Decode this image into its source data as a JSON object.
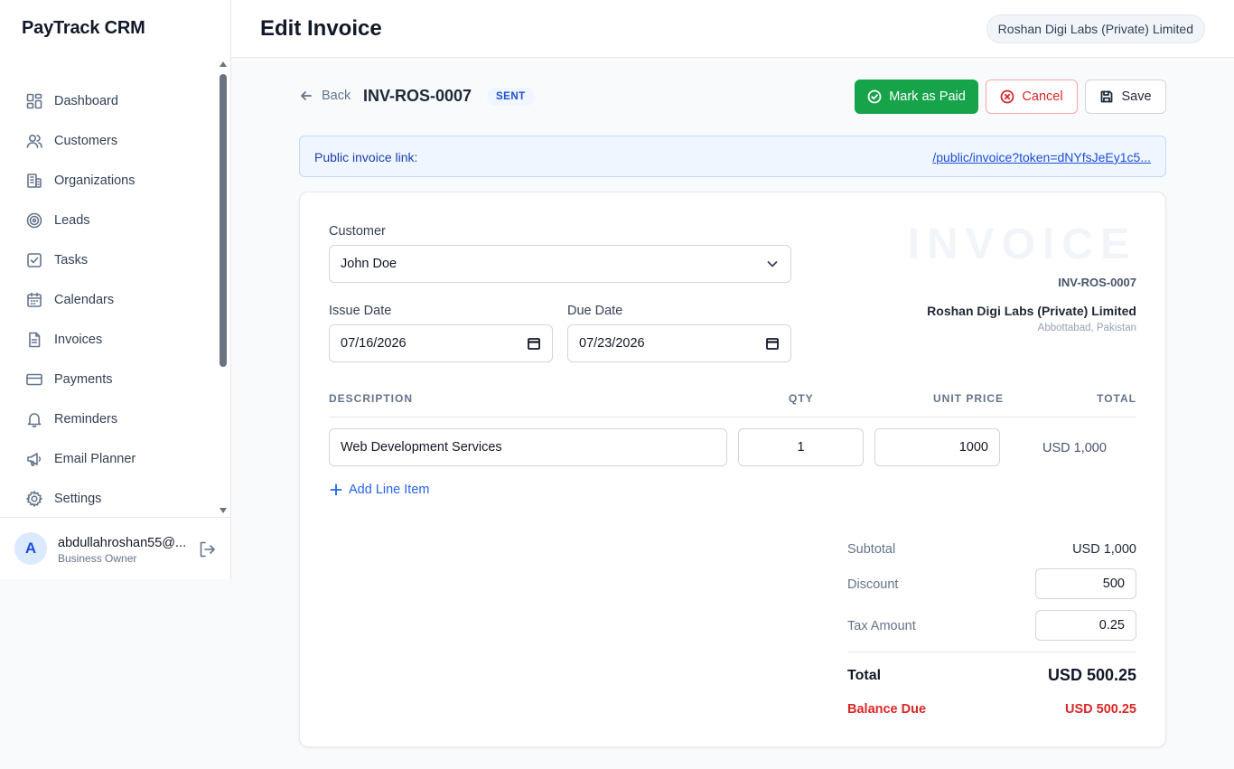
{
  "brand": "PayTrack CRM",
  "header": {
    "title": "Edit Invoice",
    "organization": "Roshan Digi Labs (Private) Limited"
  },
  "sidebar": {
    "items": [
      {
        "label": "Dashboard",
        "icon": "dashboard-icon"
      },
      {
        "label": "Customers",
        "icon": "users-icon"
      },
      {
        "label": "Organizations",
        "icon": "building-icon"
      },
      {
        "label": "Leads",
        "icon": "target-icon"
      },
      {
        "label": "Tasks",
        "icon": "checkbox-icon"
      },
      {
        "label": "Calendars",
        "icon": "calendar-icon"
      },
      {
        "label": "Invoices",
        "icon": "document-icon"
      },
      {
        "label": "Payments",
        "icon": "credit-card-icon"
      },
      {
        "label": "Reminders",
        "icon": "bell-icon"
      },
      {
        "label": "Email Planner",
        "icon": "megaphone-icon"
      },
      {
        "label": "Settings",
        "icon": "gear-icon"
      }
    ]
  },
  "user": {
    "initial": "A",
    "email": "abdullahroshan55@...",
    "role": "Business Owner"
  },
  "toolbar": {
    "back_label": "Back",
    "invoice_number": "INV-ROS-0007",
    "status": "SENT",
    "mark_paid_label": "Mark as Paid",
    "cancel_label": "Cancel",
    "save_label": "Save"
  },
  "public_link": {
    "label": "Public invoice link:",
    "url": "/public/invoice?token=dNYfsJeEy1c5..."
  },
  "invoice": {
    "watermark": "INVOICE",
    "number": "INV-ROS-0007",
    "org_name": "Roshan Digi Labs (Private) Limited",
    "org_location": "Abbottabad, Pakistan",
    "customer_label": "Customer",
    "customer_value": "John Doe",
    "issue_date_label": "Issue Date",
    "issue_date": "07/16/2026",
    "due_date_label": "Due Date",
    "due_date": "07/23/2026",
    "columns": {
      "description": "DESCRIPTION",
      "qty": "QTY",
      "unit_price": "UNIT PRICE",
      "total": "TOTAL"
    },
    "line_items": [
      {
        "description": "Web Development Services",
        "qty": "1",
        "unit_price": "1000",
        "total": "USD 1,000"
      }
    ],
    "add_line_label": "Add Line Item",
    "summary": {
      "subtotal_label": "Subtotal",
      "subtotal": "USD 1,000",
      "discount_label": "Discount",
      "discount": "500",
      "tax_label": "Tax Amount",
      "tax": "0.25",
      "total_label": "Total",
      "total": "USD 500.25",
      "balance_label": "Balance Due",
      "balance": "USD 500.25"
    }
  },
  "colors": {
    "accent": "#2563eb",
    "success": "#16a34a",
    "danger": "#dc2626"
  }
}
